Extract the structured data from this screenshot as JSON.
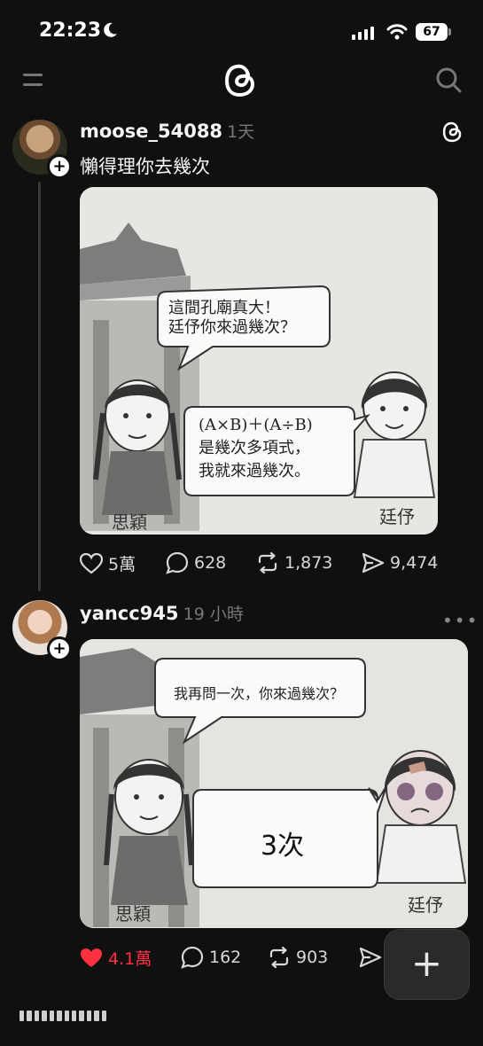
{
  "status_bar": {
    "time": "22:23",
    "battery": "67"
  },
  "posts": [
    {
      "username": "moose_54088",
      "time": "1天",
      "text": "懶得理你去幾次",
      "image": {
        "bubble_left": [
          "這間孔廟真大！",
          "廷伃你來過幾次？"
        ],
        "bubble_right": [
          "(A×B)＋(A÷B)",
          "是幾次多項式，",
          "我就來過幾次。"
        ],
        "label_left": "思穎",
        "label_right": "廷伃"
      },
      "likes": "5萬",
      "comments": "628",
      "reposts": "1,873",
      "shares": "9,474"
    },
    {
      "username": "yancc945",
      "time": "19 小時",
      "image": {
        "bubble_top": "我再問一次，你來過幾次？",
        "bubble_big": "3次",
        "label_left": "思穎",
        "label_right": "廷伃"
      },
      "likes": "4.1萬",
      "comments": "162",
      "reposts": "903"
    }
  ],
  "fab_label": "+",
  "colors": {
    "background": "#101010",
    "like_active": "#ff3040"
  }
}
